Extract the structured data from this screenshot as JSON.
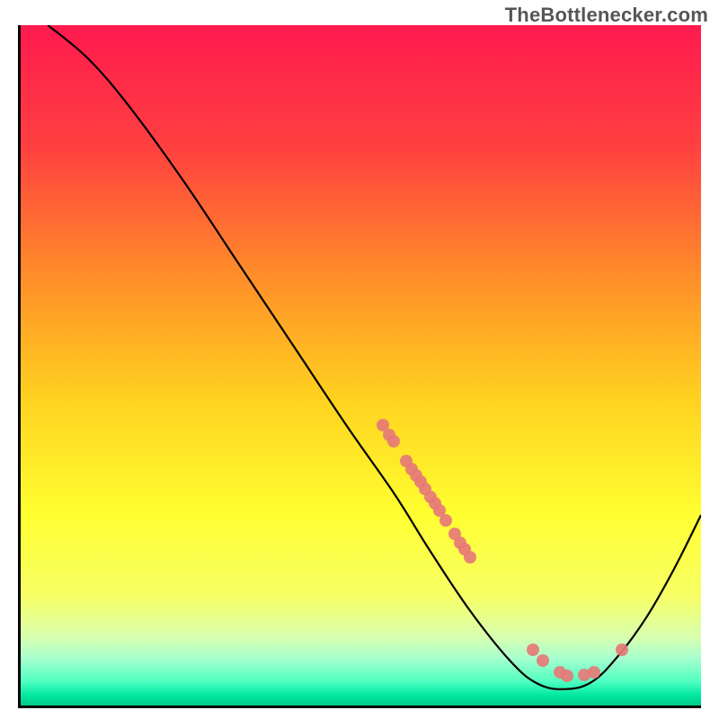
{
  "attribution": "TheBottlenecker.com",
  "chart_data": {
    "type": "line",
    "title": "",
    "xlabel": "",
    "ylabel": "",
    "xlim": [
      0,
      100
    ],
    "ylim": [
      0,
      100
    ],
    "grid": false,
    "series": [
      {
        "name": "curve",
        "points": [
          {
            "x": 4.0,
            "y": 100.0
          },
          {
            "x": 10.0,
            "y": 95.0
          },
          {
            "x": 16.0,
            "y": 88.0
          },
          {
            "x": 24.0,
            "y": 77.0
          },
          {
            "x": 32.0,
            "y": 65.0
          },
          {
            "x": 40.0,
            "y": 53.0
          },
          {
            "x": 48.0,
            "y": 41.0
          },
          {
            "x": 55.0,
            "y": 31.0
          },
          {
            "x": 60.0,
            "y": 23.0
          },
          {
            "x": 66.0,
            "y": 14.0
          },
          {
            "x": 72.0,
            "y": 6.5
          },
          {
            "x": 76.0,
            "y": 3.2
          },
          {
            "x": 80.0,
            "y": 2.4
          },
          {
            "x": 84.0,
            "y": 3.5
          },
          {
            "x": 88.0,
            "y": 7.5
          },
          {
            "x": 92.0,
            "y": 13.0
          },
          {
            "x": 96.0,
            "y": 20.0
          },
          {
            "x": 100.0,
            "y": 28.0
          }
        ]
      }
    ],
    "markers": [
      {
        "x": 53.0,
        "y": 41.5
      },
      {
        "x": 54.0,
        "y": 40.0
      },
      {
        "x": 54.6,
        "y": 39.1
      },
      {
        "x": 56.5,
        "y": 36.2
      },
      {
        "x": 57.3,
        "y": 35.0
      },
      {
        "x": 57.9,
        "y": 34.1
      },
      {
        "x": 58.5,
        "y": 33.2
      },
      {
        "x": 59.2,
        "y": 32.1
      },
      {
        "x": 60.0,
        "y": 30.9
      },
      {
        "x": 60.6,
        "y": 30.0
      },
      {
        "x": 61.3,
        "y": 28.9
      },
      {
        "x": 62.2,
        "y": 27.5
      },
      {
        "x": 63.5,
        "y": 25.5
      },
      {
        "x": 64.4,
        "y": 24.2
      },
      {
        "x": 65.0,
        "y": 23.3
      },
      {
        "x": 65.8,
        "y": 22.1
      },
      {
        "x": 75.0,
        "y": 8.5
      },
      {
        "x": 76.5,
        "y": 7.0
      },
      {
        "x": 79.0,
        "y": 5.2
      },
      {
        "x": 80.0,
        "y": 4.8
      },
      {
        "x": 82.5,
        "y": 4.9
      },
      {
        "x": 84.0,
        "y": 5.3
      },
      {
        "x": 88.0,
        "y": 8.5
      }
    ],
    "gradient_stops": [
      {
        "offset": 0.0,
        "color": "#ff1a4f"
      },
      {
        "offset": 0.18,
        "color": "#ff4040"
      },
      {
        "offset": 0.36,
        "color": "#ff8a2a"
      },
      {
        "offset": 0.55,
        "color": "#ffd21f"
      },
      {
        "offset": 0.72,
        "color": "#ffff30"
      },
      {
        "offset": 0.84,
        "color": "#f7ff66"
      },
      {
        "offset": 0.9,
        "color": "#d8ffb0"
      },
      {
        "offset": 0.93,
        "color": "#a8ffcf"
      },
      {
        "offset": 0.965,
        "color": "#4fffc0"
      },
      {
        "offset": 0.985,
        "color": "#00e8a0"
      },
      {
        "offset": 1.0,
        "color": "#00c887"
      }
    ]
  }
}
